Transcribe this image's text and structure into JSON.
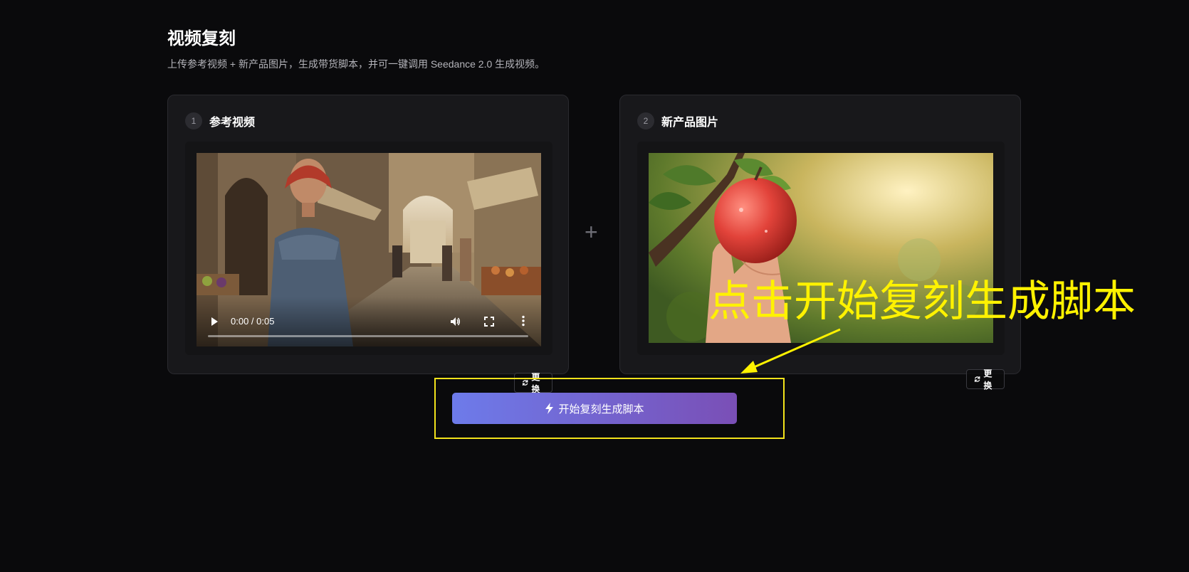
{
  "header": {
    "title": "视频复刻",
    "subtitle": "上传参考视频 + 新产品图片，生成带货脚本，并可一键调用 Seedance 2.0 生成视频。"
  },
  "reference_card": {
    "step": "1",
    "title": "参考视频",
    "video": {
      "time_display": "0:00 / 0:05",
      "progress": 0
    },
    "replace_label": "更换"
  },
  "plus": "+",
  "product_card": {
    "step": "2",
    "title": "新产品图片",
    "replace_label": "更换"
  },
  "start_button": {
    "label": "开始复刻生成脚本"
  },
  "annotation": {
    "text": "点击开始复刻生成脚本",
    "color": "#fff200"
  },
  "colors": {
    "background": "#0a0a0c",
    "card": "#18181b",
    "button_gradient_start": "#6d7bea",
    "button_gradient_end": "#7a4fb6",
    "highlight": "#f2e21b"
  },
  "icons": {
    "play": "play-icon",
    "volume": "volume-icon",
    "fullscreen": "fullscreen-icon",
    "more": "more-vertical-icon",
    "refresh": "refresh-icon",
    "bolt": "bolt-icon",
    "plus": "plus-icon"
  }
}
